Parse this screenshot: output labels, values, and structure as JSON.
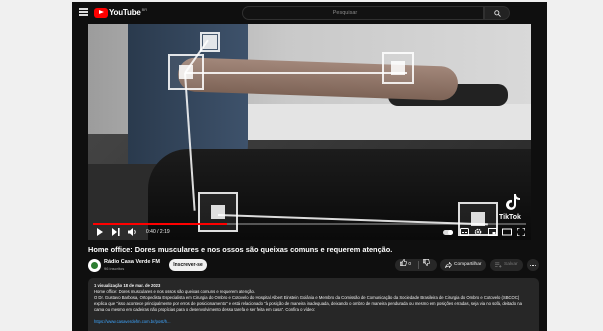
{
  "header": {
    "logo_text": "YouTube",
    "logo_sup": "BR",
    "search_placeholder": "Pesquisar"
  },
  "player": {
    "time": "0:40 / 2:19",
    "progress_fraction": 0.31,
    "watermark": "TikTok"
  },
  "video": {
    "title": "Home office: Dores musculares e nos ossos são queixas comuns e requerem atenção."
  },
  "channel": {
    "name": "Rádio Casa Verde FM",
    "subscribers": "96 inscritos",
    "subscribe_label": "Inscrever-se"
  },
  "actions": {
    "like_count": "0",
    "share_label": "Compartilhar",
    "save_label": "Salvar"
  },
  "description": {
    "meta": "1 visualização  18 de mar. de 2023",
    "line1": "Home office: Dores musculares e nos ossos são queixas comuns e requerem atenção.",
    "line2": "O Dr. Gustavo Barbosa, Ortopedista Especialista em Cirurgia do Ombro e Cotovelo do Hospital Albert Einstein Goiânia e Membro da Comissão de Comunicação da Sociedade Brasileira de Cirurgia do Ombro e Cotovelo (SBCOC) explica que \"isso acontece principalmente por erros de posicionamento\" e está relacionado \"à posição de maneira inadequada, deixando o ombro de maneira pendurada ou mesmo em posições erradas, seja via no sofá, deitado na cama ou mesmo em cadeiras não propícias para o desenvolvimento dessa tarefa e ser feita em casa\". Confira o vídeo:",
    "link": "https://www.casaverdefm.com.br/post/h..."
  }
}
